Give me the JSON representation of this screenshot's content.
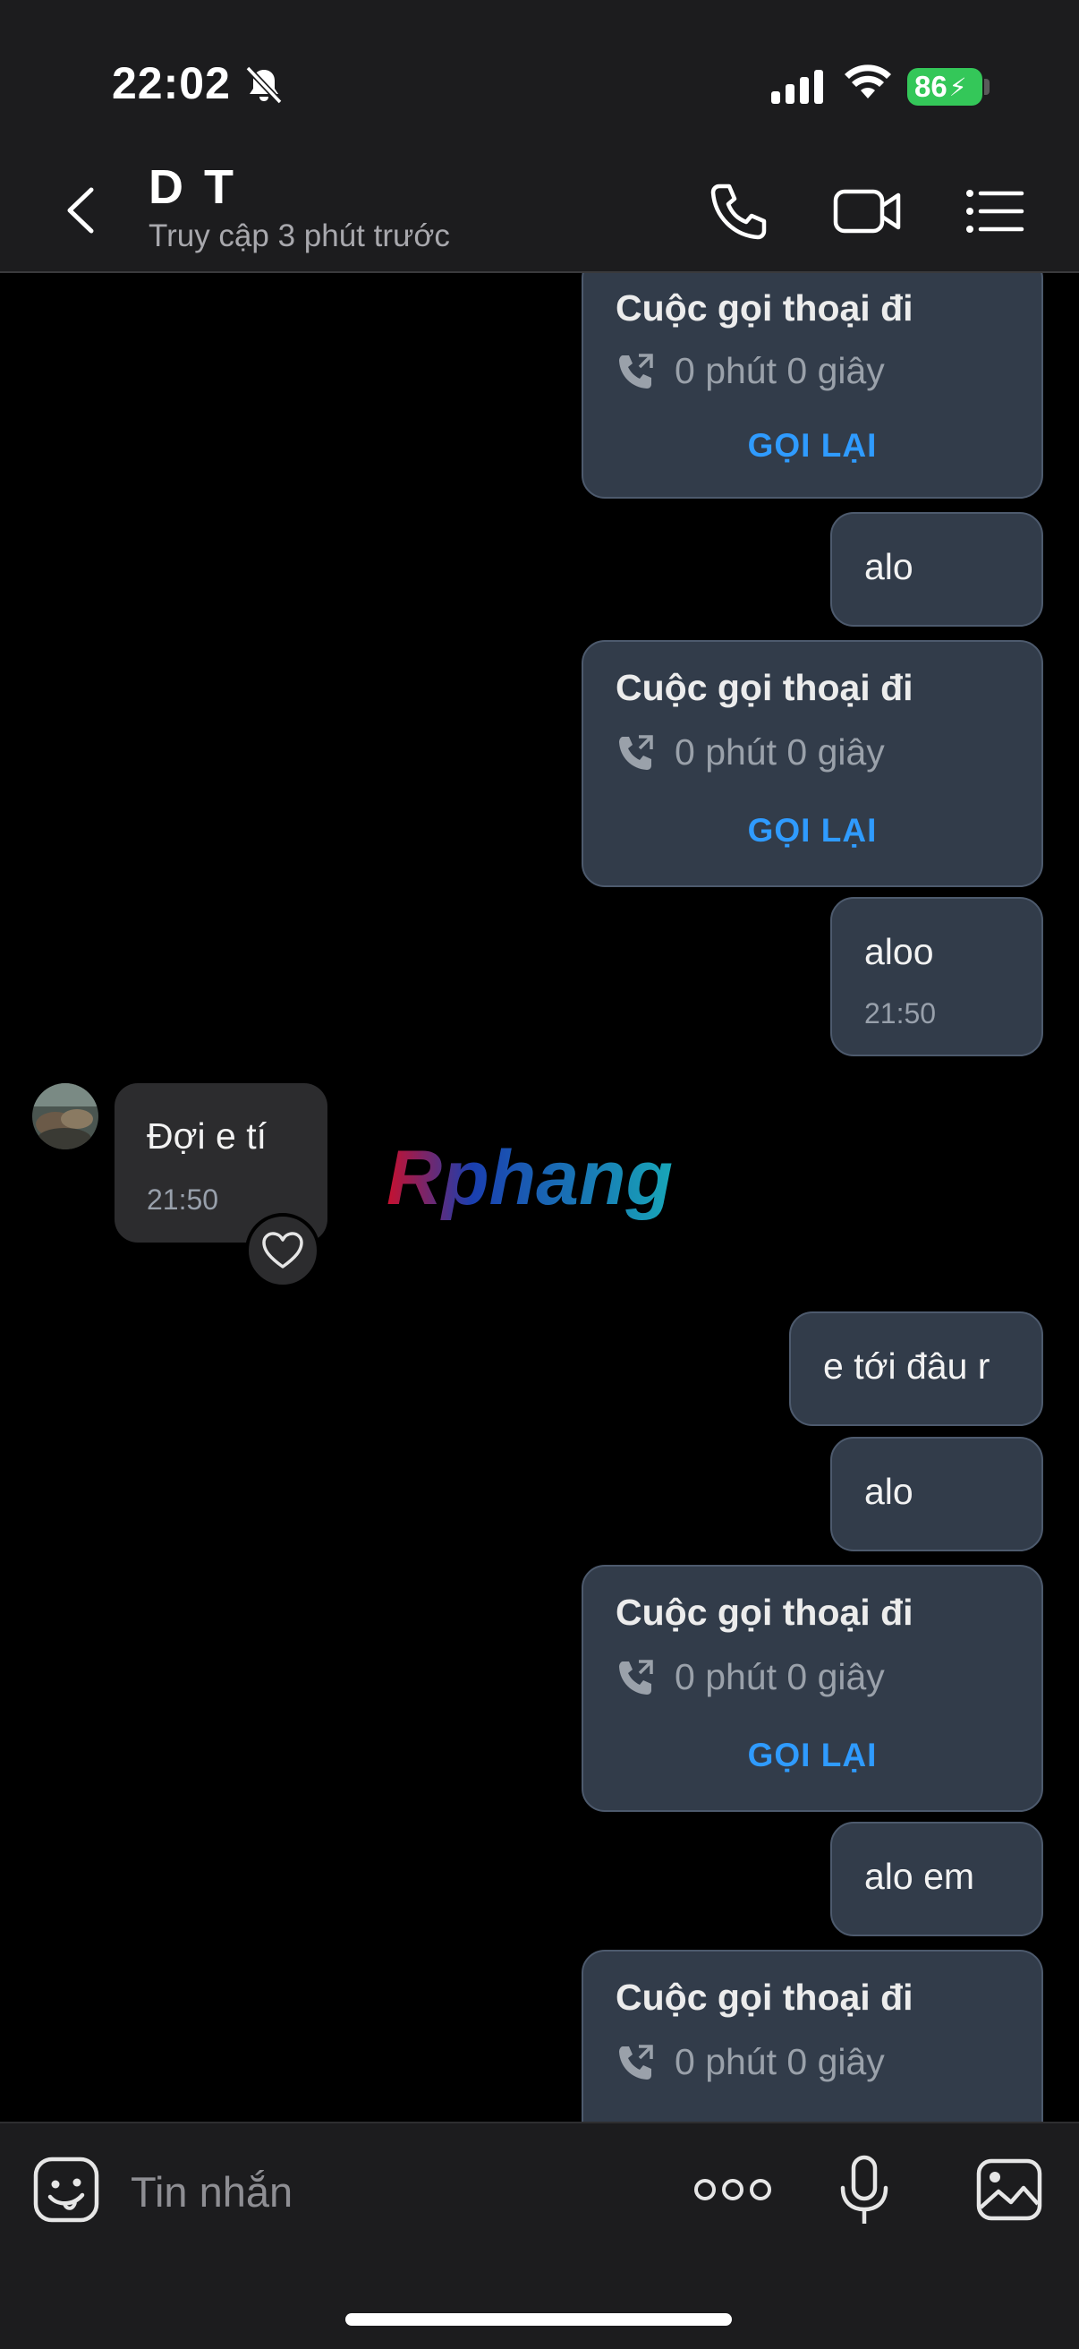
{
  "status_bar": {
    "time": "22:02",
    "battery_level": "86",
    "battery_color": "#34c759"
  },
  "header": {
    "contact_name": "D T",
    "contact_status": "Truy cập 3 phút trước"
  },
  "messages": [
    {
      "type": "call",
      "direction": "outgoing",
      "title": "Cuộc gọi thoại đi",
      "duration": "0 phút 0 giây",
      "action": "GỌI LẠI"
    },
    {
      "type": "text",
      "direction": "outgoing",
      "text": "alo"
    },
    {
      "type": "call",
      "direction": "outgoing",
      "title": "Cuộc gọi thoại đi",
      "duration": "0 phút 0 giây",
      "action": "GỌI LẠI"
    },
    {
      "type": "text",
      "direction": "outgoing",
      "text": "aloo",
      "time": "21:50"
    },
    {
      "type": "text",
      "direction": "incoming",
      "text": "Đợi e tí",
      "time": "21:50"
    },
    {
      "type": "text",
      "direction": "outgoing",
      "text": "e tới đâu r"
    },
    {
      "type": "text",
      "direction": "outgoing",
      "text": "alo"
    },
    {
      "type": "call",
      "direction": "outgoing",
      "title": "Cuộc gọi thoại đi",
      "duration": "0 phút 0 giây",
      "action": "GỌI LẠI"
    },
    {
      "type": "text",
      "direction": "outgoing",
      "text": "alo em"
    },
    {
      "type": "call",
      "direction": "outgoing",
      "title": "Cuộc gọi thoại đi",
      "duration": "0 phút 0 giây"
    }
  ],
  "watermark": {
    "text": "Rphang"
  },
  "composer": {
    "placeholder": "Tin nhắn"
  },
  "colors": {
    "accent_blue": "#2f9bff",
    "outgoing_bubble": "#323c4a",
    "incoming_bubble": "#2c2c2e"
  }
}
